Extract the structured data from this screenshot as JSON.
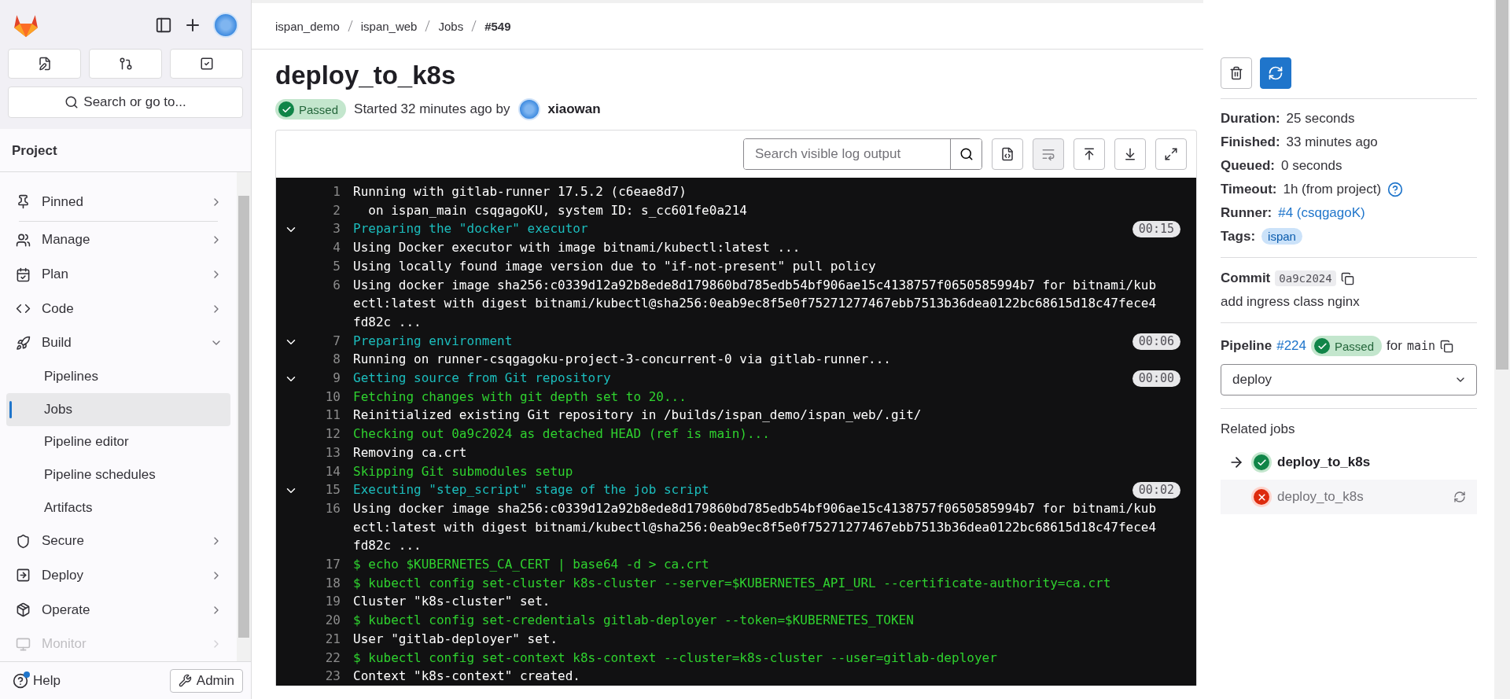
{
  "sidebar": {
    "search_button": "Search or go to...",
    "section_title": "Project",
    "nav": [
      {
        "label": "Pinned",
        "expanded": false,
        "faded": false
      },
      {
        "label": "Manage",
        "expanded": false,
        "faded": false
      },
      {
        "label": "Plan",
        "expanded": false,
        "faded": false
      },
      {
        "label": "Code",
        "expanded": false,
        "faded": false
      },
      {
        "label": "Build",
        "expanded": true,
        "faded": false,
        "children": [
          {
            "label": "Pipelines",
            "selected": false
          },
          {
            "label": "Jobs",
            "selected": true
          },
          {
            "label": "Pipeline editor",
            "selected": false
          },
          {
            "label": "Pipeline schedules",
            "selected": false
          },
          {
            "label": "Artifacts",
            "selected": false
          }
        ]
      },
      {
        "label": "Secure",
        "expanded": false,
        "faded": false
      },
      {
        "label": "Deploy",
        "expanded": false,
        "faded": false
      },
      {
        "label": "Operate",
        "expanded": false,
        "faded": false
      },
      {
        "label": "Monitor",
        "expanded": false,
        "faded": true
      }
    ],
    "help": "Help",
    "admin": "Admin"
  },
  "breadcrumb": [
    "ispan_demo",
    "ispan_web",
    "Jobs",
    "#549"
  ],
  "job": {
    "title": "deploy_to_k8s",
    "status": "Passed",
    "started": "Started 32 minutes ago by",
    "user": "xiaowan"
  },
  "log": {
    "search_placeholder": "Search visible log output",
    "lines": [
      {
        "n": "1",
        "kind": "plain",
        "text": "Running with gitlab-runner 17.5.2 (c6eae8d7)"
      },
      {
        "n": "2",
        "kind": "plain",
        "text": "  on ispan_main csqgagoKU, system ID: s_cc601fe0a214"
      },
      {
        "n": "3",
        "kind": "section",
        "text": "Preparing the \"docker\" executor",
        "duration": "00:15",
        "expanded": true
      },
      {
        "n": "4",
        "kind": "plain",
        "text": "Using Docker executor with image bitnami/kubectl:latest ..."
      },
      {
        "n": "5",
        "kind": "plain",
        "text": "Using locally found image version due to \"if-not-present\" pull policy"
      },
      {
        "n": "6",
        "kind": "plain",
        "text": "Using docker image sha256:c0339d12a92b8ede8d179860bd785edb54bf906ae15c4138757f0650585994b7 for bitnami/kubectl:latest with digest bitnami/kubectl@sha256:0eab9ec8f5e0f75271277467ebb7513b36dea0122bc68615d18c47fece4fd82c ..."
      },
      {
        "n": "7",
        "kind": "section",
        "text": "Preparing environment",
        "duration": "00:06",
        "expanded": true
      },
      {
        "n": "8",
        "kind": "plain",
        "text": "Running on runner-csqgagoku-project-3-concurrent-0 via gitlab-runner..."
      },
      {
        "n": "9",
        "kind": "section",
        "text": "Getting source from Git repository",
        "duration": "00:00",
        "expanded": true
      },
      {
        "n": "10",
        "kind": "green",
        "text": "Fetching changes with git depth set to 20..."
      },
      {
        "n": "11",
        "kind": "plain",
        "text": "Reinitialized existing Git repository in /builds/ispan_demo/ispan_web/.git/"
      },
      {
        "n": "12",
        "kind": "green",
        "text": "Checking out 0a9c2024 as detached HEAD (ref is main)..."
      },
      {
        "n": "13",
        "kind": "plain",
        "text": "Removing ca.crt"
      },
      {
        "n": "14",
        "kind": "green",
        "text": "Skipping Git submodules setup"
      },
      {
        "n": "15",
        "kind": "section",
        "text": "Executing \"step_script\" stage of the job script",
        "duration": "00:02",
        "expanded": true
      },
      {
        "n": "16",
        "kind": "plain",
        "text": "Using docker image sha256:c0339d12a92b8ede8d179860bd785edb54bf906ae15c4138757f0650585994b7 for bitnami/kubectl:latest with digest bitnami/kubectl@sha256:0eab9ec8f5e0f75271277467ebb7513b36dea0122bc68615d18c47fece4fd82c ..."
      },
      {
        "n": "17",
        "kind": "green",
        "text": "$ echo $KUBERNETES_CA_CERT | base64 -d > ca.crt"
      },
      {
        "n": "18",
        "kind": "green",
        "text": "$ kubectl config set-cluster k8s-cluster --server=$KUBERNETES_API_URL --certificate-authority=ca.crt"
      },
      {
        "n": "19",
        "kind": "plain",
        "text": "Cluster \"k8s-cluster\" set."
      },
      {
        "n": "20",
        "kind": "green",
        "text": "$ kubectl config set-credentials gitlab-deployer --token=$KUBERNETES_TOKEN"
      },
      {
        "n": "21",
        "kind": "plain",
        "text": "User \"gitlab-deployer\" set."
      },
      {
        "n": "22",
        "kind": "green",
        "text": "$ kubectl config set-context k8s-context --cluster=k8s-cluster --user=gitlab-deployer"
      },
      {
        "n": "23",
        "kind": "plain",
        "text": "Context \"k8s-context\" created."
      }
    ]
  },
  "details": [
    {
      "label": "Duration:",
      "kind": "text",
      "value": "25 seconds"
    },
    {
      "label": "Finished:",
      "kind": "text",
      "value": "33 minutes ago"
    },
    {
      "label": "Queued:",
      "kind": "text",
      "value": "0 seconds"
    },
    {
      "label": "Timeout:",
      "kind": "help",
      "value": "1h (from project)"
    },
    {
      "label": "Runner:",
      "kind": "link",
      "value": "#4 (csqgagoK)"
    },
    {
      "label": "Tags:",
      "kind": "tag",
      "value": "ispan"
    }
  ],
  "commit": {
    "label": "Commit",
    "sha": "0a9c2024",
    "message": "add ingress class nginx"
  },
  "pipeline": {
    "label": "Pipeline",
    "id": "#224",
    "status": "Passed",
    "for": "for",
    "ref": "main",
    "stage": "deploy"
  },
  "related": {
    "title": "Related jobs",
    "jobs": [
      {
        "name": "deploy_to_k8s",
        "kind": "success",
        "selected": true
      },
      {
        "name": "deploy_to_k8s",
        "kind": "failed",
        "selected": false
      }
    ]
  }
}
